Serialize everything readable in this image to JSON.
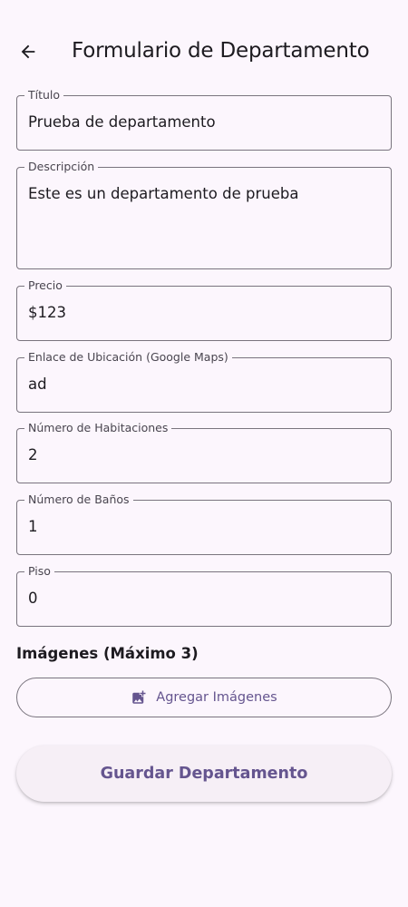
{
  "header": {
    "title": "Formulario de Departamento",
    "back_icon": "arrow-back-icon"
  },
  "form": {
    "titulo": {
      "label": "Título",
      "value": "Prueba de departamento"
    },
    "descripcion": {
      "label": "Descripción",
      "value": "Este es un departamento de prueba"
    },
    "precio": {
      "label": "Precio",
      "value": "$123"
    },
    "ubicacion": {
      "label": "Enlace de Ubicación (Google Maps)",
      "value": "ad"
    },
    "habitaciones": {
      "label": "Número de Habitaciones",
      "value": "2"
    },
    "banos": {
      "label": "Número de Baños",
      "value": "1"
    },
    "piso": {
      "label": "Piso",
      "value": "0"
    }
  },
  "images": {
    "section_title": "Imágenes (Máximo 3)",
    "add_button_label": "Agregar Imágenes",
    "add_button_icon": "add-photo-icon"
  },
  "actions": {
    "save_label": "Guardar Departamento"
  },
  "colors": {
    "background": "#fcf6fd",
    "primary": "#65558f",
    "outline": "#79747e",
    "on_surface": "#1d1b20",
    "label": "#49454f"
  }
}
